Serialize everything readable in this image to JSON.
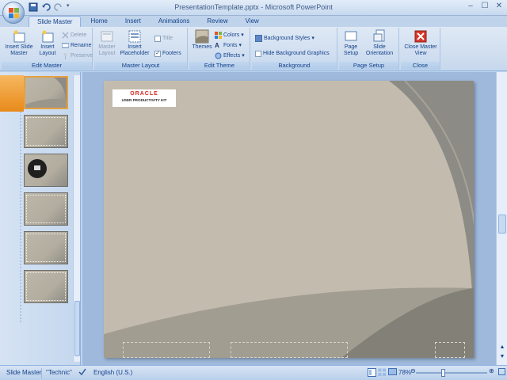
{
  "window": {
    "title": "PresentationTemplate.pptx - Microsoft PowerPoint",
    "min": "–",
    "max": "☐",
    "close": "✕"
  },
  "tabs": [
    "Slide Master",
    "Home",
    "Insert",
    "Animations",
    "Review",
    "View"
  ],
  "ribbon": {
    "edit_master": {
      "label": "Edit Master",
      "insert_slide_master": "Insert Slide Master",
      "insert_layout": "Insert Layout",
      "delete": "Delete",
      "rename": "Rename",
      "preserve": "Preserve"
    },
    "master_layout": {
      "label": "Master Layout",
      "master_layout": "Master Layout",
      "insert_placeholder": "Insert Placeholder",
      "title": "Title",
      "title_checked": false,
      "footers": "Footers",
      "footers_checked": true
    },
    "edit_theme": {
      "label": "Edit Theme",
      "themes": "Themes",
      "colors": "Colors",
      "fonts": "Fonts",
      "effects": "Effects"
    },
    "background": {
      "label": "Background",
      "background_styles": "Background Styles",
      "hide_background_graphics": "Hide Background Graphics",
      "hide_checked": false
    },
    "page_setup": {
      "label": "Page Setup",
      "page_setup": "Page Setup",
      "slide_orientation": "Slide Orientation"
    },
    "close": {
      "label": "Close",
      "close_master_view": "Close Master View"
    }
  },
  "slide": {
    "logo_name": "ORACLE",
    "logo_sub": "USER PRODUCTIVITY KIT"
  },
  "status": {
    "view": "Slide Master",
    "theme": "\"Technic\"",
    "language": "English (U.S.)",
    "zoom": "78%"
  },
  "colors": {
    "slide_bg": "#c3bcae",
    "slide_dark": "#8c8b85",
    "accent_orange": "#e88a1a"
  }
}
